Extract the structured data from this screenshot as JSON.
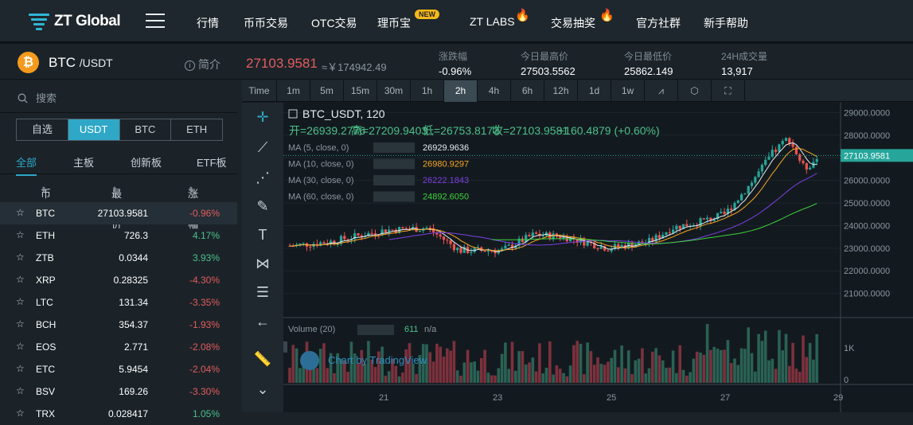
{
  "nav": {
    "logo": "ZT Global",
    "items": [
      "行情",
      "币币交易",
      "OTC交易",
      "理币宝",
      "ZT LABS",
      "交易抽奖",
      "官方社群",
      "新手帮助"
    ],
    "new_badge": "NEW"
  },
  "ticker": {
    "coin_icon": "₿",
    "base": "BTC",
    "quote": "/USDT",
    "intro": "简介",
    "last_price": "27103.9581",
    "cny_price": "≈￥174942.49",
    "stats": [
      {
        "label": "涨跌幅",
        "value": "-0.96%"
      },
      {
        "label": "今日最高价",
        "value": "27503.5562"
      },
      {
        "label": "今日最低价",
        "value": "25862.149"
      },
      {
        "label": "24H成交量",
        "value": "13,917"
      }
    ]
  },
  "market": {
    "search_placeholder": "搜索",
    "quote_tabs": [
      "自选",
      "USDT",
      "BTC",
      "ETH"
    ],
    "active_quote": "USDT",
    "category_tabs": [
      "全部",
      "主板",
      "创新板",
      "ETF板"
    ],
    "headers": [
      "币种",
      "最新价",
      "涨跌幅"
    ],
    "rows": [
      {
        "sym": "BTC",
        "price": "27103.9581",
        "change": "-0.96%"
      },
      {
        "sym": "ETH",
        "price": "726.3",
        "change": "4.17%"
      },
      {
        "sym": "ZTB",
        "price": "0.0344",
        "change": "3.93%"
      },
      {
        "sym": "XRP",
        "price": "0.28325",
        "change": "-4.30%"
      },
      {
        "sym": "LTC",
        "price": "131.34",
        "change": "-3.35%"
      },
      {
        "sym": "BCH",
        "price": "354.37",
        "change": "-1.93%"
      },
      {
        "sym": "EOS",
        "price": "2.771",
        "change": "-2.08%"
      },
      {
        "sym": "ETC",
        "price": "5.9454",
        "change": "-2.04%"
      },
      {
        "sym": "BSV",
        "price": "169.26",
        "change": "-3.30%"
      },
      {
        "sym": "TRX",
        "price": "0.028417",
        "change": "1.05%"
      }
    ]
  },
  "chart_toolbar": [
    "Time",
    "1m",
    "5m",
    "15m",
    "30m",
    "1h",
    "2h",
    "4h",
    "6h",
    "12h",
    "1d",
    "1w"
  ],
  "active_interval": "2h",
  "chart_data": {
    "type": "line",
    "title": "BTC_USDT, 120",
    "ohlc": {
      "open": "开=26939.2776",
      "high": "高=27209.9403",
      "low": "低=26753.8173",
      "close": "收=27103.9581",
      "change": "+160.4879 (+0.60%)"
    },
    "indicators": [
      {
        "label": "MA (5, close, 0)",
        "value": "26929.9636",
        "color": "#e8edf0"
      },
      {
        "label": "MA (10, close, 0)",
        "value": "26980.9297",
        "color": "#f5a623"
      },
      {
        "label": "MA (30, close, 0)",
        "value": "26222.1843",
        "color": "#7b3fe4"
      },
      {
        "label": "MA (60, close, 0)",
        "value": "24892.6050",
        "color": "#3ed13e"
      }
    ],
    "volume_label": "Volume (20)",
    "volume_value": "611",
    "volume_na": "n/a",
    "y_ticks": [
      "29000.0000",
      "28000.0000",
      "27000.0000",
      "26000.0000",
      "25000.0000",
      "24000.0000",
      "23000.0000",
      "22000.0000",
      "21000.0000"
    ],
    "price_tag": "27103.9581",
    "vol_ticks": [
      "1K",
      "0"
    ],
    "x_ticks": [
      "21",
      "23",
      "25",
      "27",
      "29"
    ],
    "watermark": "Chart by TradingView",
    "ylim": [
      20000,
      29300
    ]
  }
}
